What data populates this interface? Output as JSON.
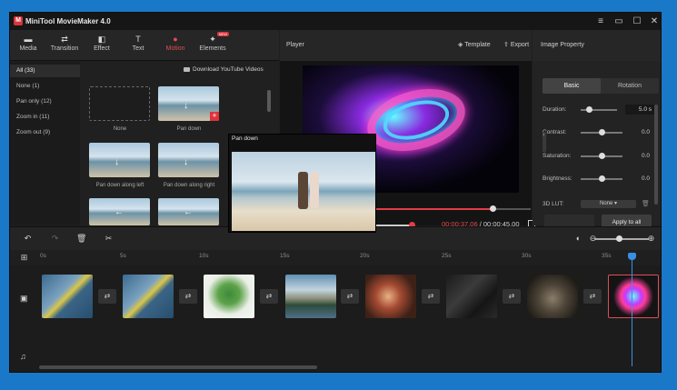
{
  "app": {
    "title": "MiniTool MovieMaker 4.0",
    "logo_glyph": "M"
  },
  "window_controls": [
    "≡",
    "▭",
    "☐",
    "✕"
  ],
  "toolbar": {
    "items": [
      {
        "label": "Media",
        "icon": "folder-icon",
        "glyph": "▬"
      },
      {
        "label": "Transition",
        "icon": "transition-icon",
        "glyph": "⇄"
      },
      {
        "label": "Effect",
        "icon": "effect-icon",
        "glyph": "◧"
      },
      {
        "label": "Text",
        "icon": "text-icon",
        "glyph": "T"
      },
      {
        "label": "Motion",
        "icon": "motion-icon",
        "glyph": "●",
        "active": true
      },
      {
        "label": "Elements",
        "icon": "elements-icon",
        "glyph": "✦",
        "badge": "NEW"
      }
    ]
  },
  "categories": [
    "All (33)",
    "None (1)",
    "Pan only (12)",
    "Zoom in (11)",
    "Zoom out (9)"
  ],
  "download_link": "Download YouTube Videos",
  "motions": [
    {
      "label": "None"
    },
    {
      "label": "Pan down"
    },
    {
      "label": "Pan down along left"
    },
    {
      "label": "Pan down along right"
    }
  ],
  "popup": {
    "label": "Pan down"
  },
  "player": {
    "title": "Player",
    "template_label": "Template",
    "export_label": "Export",
    "current_time": "00:00:37.06",
    "separator": " / ",
    "total_time": "00:00:45.00",
    "progress": 0.75
  },
  "properties": {
    "title": "Image Property",
    "tabs": [
      "Basic",
      "Rotation"
    ],
    "rows": [
      {
        "name": "Duration:",
        "value": "5.0 s"
      },
      {
        "name": "Contrast:",
        "value": "0.0"
      },
      {
        "name": "Saturation:",
        "value": "0.0"
      },
      {
        "name": "Brightness:",
        "value": "0.0"
      }
    ],
    "lut_label": "3D LUT:",
    "lut_value": "None",
    "apply_all": "Apply to all"
  },
  "timeline": {
    "ticks": [
      "0s",
      "5s",
      "10s",
      "15s",
      "20s",
      "25s",
      "30s",
      "35s"
    ],
    "transition_glyph": "⇄"
  }
}
